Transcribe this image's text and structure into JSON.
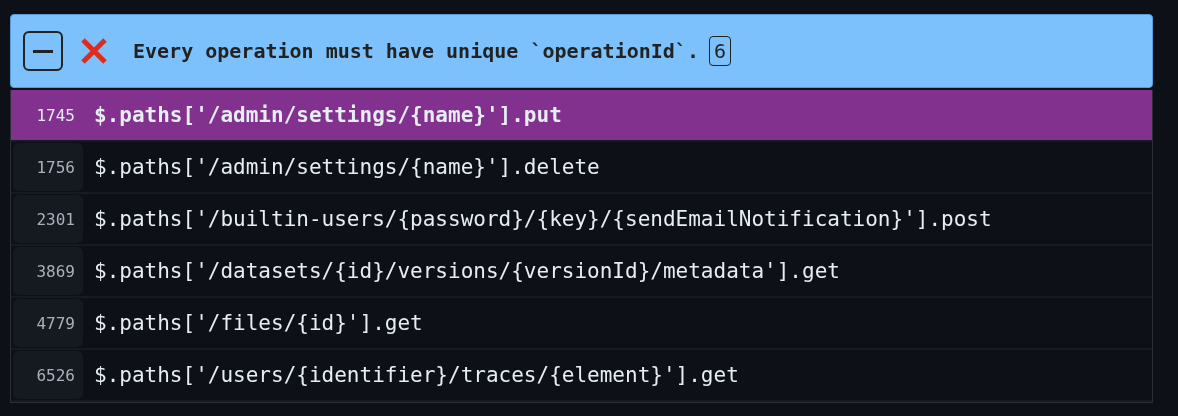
{
  "rule": {
    "expanded": true,
    "kind": "error",
    "message": "Every operation must have unique `operationId`.",
    "count": "6"
  },
  "locations": [
    {
      "line": "1745",
      "path": "$.paths['/admin/settings/{name}'].put",
      "selected": true
    },
    {
      "line": "1756",
      "path": "$.paths['/admin/settings/{name}'].delete",
      "selected": false
    },
    {
      "line": "2301",
      "path": "$.paths['/builtin-users/{password}/{key}/{sendEmailNotification}'].post",
      "selected": false
    },
    {
      "line": "3869",
      "path": "$.paths['/datasets/{id}/versions/{versionId}/metadata'].get",
      "selected": false
    },
    {
      "line": "4779",
      "path": "$.paths['/files/{id}'].get",
      "selected": false
    },
    {
      "line": "6526",
      "path": "$.paths['/users/{identifier}/traces/{element}'].get",
      "selected": false
    }
  ]
}
